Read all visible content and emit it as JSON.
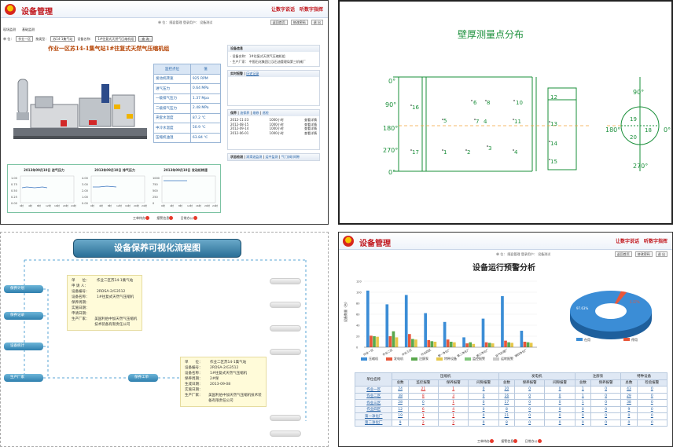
{
  "app": {
    "title": "设备管理",
    "slogan1": "让数字说话",
    "slogan2": "听数字指挥",
    "info": "单 位：   随县管理   登录用户：   设备测试",
    "links": [
      "返回首页",
      "修改密码",
      "退 出"
    ],
    "footer": [
      "工单待办",
      "报警信息",
      "日常办公"
    ]
  },
  "p1": {
    "nav": [
      "现场监测",
      "基础监测"
    ],
    "filter_unit_label": "单 位：",
    "filter_unit": "作业一区",
    "filter_type_label": "按类型：",
    "filter_type": "苏14-1集气站",
    "filter_device_label": "设备名称：",
    "filter_device": "1#往复式天然气压缩机组",
    "query": "查 询",
    "title": "作业一区苏14-1集气站1#往复式天然气压缩机组",
    "params_header": [
      "监控点位",
      "值"
    ],
    "params": [
      [
        "发动机转速",
        "925 RPM"
      ],
      [
        "进气压力",
        "0.64 MPa"
      ],
      [
        "一级排气压力",
        "1.37 Mpa"
      ],
      [
        "二级排气压力",
        "2.48 MPa"
      ],
      [
        "夹套水温度",
        "87.2 ℃"
      ],
      [
        "中冷水温度",
        "50.9 ℃"
      ],
      [
        "压缩机油温",
        "63.84 ℃"
      ]
    ],
    "info_box_title": "设备信息",
    "info_name": "· 设备名称：    1#往复式天然气压缩机组",
    "info_maker": "· 生产厂家：    中国石化集团江汉石油管理局第三机械厂",
    "alarm_title": "实时报警",
    "alarm_link": "历史记录",
    "list_title": "保养",
    "list_tabs": [
      "油保养",
      "维修",
      "巡检"
    ],
    "list": [
      [
        "2012-11-23",
        "1000小时",
        "查看详情"
      ],
      [
        "2012-08-15",
        "1000小时",
        "查看详情"
      ],
      [
        "2012-09-14",
        "1000小时",
        "查看详情"
      ],
      [
        "2012-06-01",
        "1000小时",
        "查看详情"
      ]
    ],
    "bottom_title": "状态检测",
    "bottom_links": [
      "润滑油监测",
      "运中监测",
      "气门(阀)间隙"
    ],
    "trend_titles": [
      "2013年09月10日 进气压力",
      "2013年09月10日 排气压力",
      "2013年09月10日 发动机转速"
    ],
    "trend_ylabels": [
      [
        "1.00",
        "0.75",
        "0.50",
        "0.25",
        "0.00"
      ],
      [
        "4.00",
        "3.00",
        "2.00",
        "1.00",
        "0.00"
      ],
      [
        "1000",
        "750",
        "500",
        "250",
        "0"
      ]
    ],
    "trend_xlabels": [
      "0时",
      "4时",
      "8时",
      "12时",
      "16时",
      "20时",
      "24时"
    ]
  },
  "p2": {
    "title": "壁厚测量点分布",
    "left_angles": [
      "0°",
      "90°",
      "180°",
      "270°",
      "0°"
    ],
    "points": [
      "16",
      "6",
      "8",
      "10",
      "12",
      "5",
      "7",
      "4",
      "11",
      "13",
      "17",
      "1",
      "2",
      "3",
      "4",
      "14",
      "15"
    ],
    "right_angles": [
      "90°",
      "180°",
      "0°",
      "270°"
    ],
    "right_points": [
      "19",
      "18",
      "20"
    ]
  },
  "p3": {
    "title": "设备保养可视化流程图",
    "nodes": [
      "保养计划",
      "保养记录",
      "设备统计",
      "生产厂家",
      "保养工单"
    ],
    "note_top": [
      [
        "单　　位：",
        "作业二区苏14-1集气站"
      ],
      [
        "申 请 人：",
        ""
      ],
      [
        "设备编号：",
        "2RDSA-2/G3512"
      ],
      [
        "设备名称：",
        "1#往复式天然气压缩机"
      ],
      [
        "保养周期：",
        ""
      ],
      [
        "实施日期：",
        ""
      ],
      [
        "申请日期：",
        ""
      ],
      [
        "生产厂家：",
        "美国利伯中加天然气压缩机技术装备有限责任公司"
      ]
    ],
    "note_bottom": [
      [
        "单　　位：",
        "作业二区苏14-1集气站"
      ],
      [
        "设备编号：",
        "2RDSA-2/G3512"
      ],
      [
        "设备名称：",
        "1#往复式天然气压缩机"
      ],
      [
        "保养周期：",
        "2#保"
      ],
      [
        "生成日期：",
        "2013-09-08"
      ],
      [
        "实施日期：",
        ""
      ],
      [
        "生产厂家：",
        "美国利伯中加天然气压缩机技术装备有限责任公司"
      ]
    ]
  },
  "p4": {
    "title": "设备运行预警分析",
    "chart_data": [
      {
        "type": "bar",
        "categories": [
          "作业一区",
          "作业二区",
          "作业三区",
          "作业四区",
          "第一净化厂",
          "第二净化厂",
          "第三净化厂",
          "采气处理厂",
          "第四净化厂"
        ],
        "series": [
          {
            "name": "压缩机",
            "values": [
              103,
              78,
              95,
              62,
              46,
              18,
              52,
              93,
              30
            ]
          },
          {
            "name": "发电机",
            "values": [
              21,
              20,
              24,
              13,
              14,
              7,
              9,
              12,
              10
            ]
          },
          {
            "name": "注醇泵",
            "values": [
              20,
              29,
              15,
              11,
              10,
              9,
              8,
              9,
              9
            ]
          },
          {
            "name": "特种设备",
            "values": [
              19,
              18,
              14,
              10,
              9,
              6,
              7,
              8,
              8
            ]
          }
        ],
        "ylabel": "设备数量（台）",
        "ylim": [
          0,
          120
        ],
        "yticks": [
          "0",
          "20",
          "40",
          "60",
          "80",
          "100",
          "120"
        ],
        "legend": [
          "压缩机",
          "发电机",
          "注醇泵",
          "特种设备",
          "监控报警",
          "运转报警"
        ]
      },
      {
        "type": "pie",
        "categories": [
          "在用",
          "停用"
        ],
        "values": [
          97.63,
          2.37
        ],
        "labels": [
          "97.63%",
          "2.37%"
        ]
      }
    ],
    "table_header_groups": [
      "单位名称",
      "压缩机",
      "发电机",
      "注醇泵",
      "特种设备"
    ],
    "table_subheaders": [
      "总数",
      "监控报警",
      "保养报警",
      "间隙报警",
      "总数",
      "保养报警",
      "间隙报警",
      "总数",
      "保养报警",
      "总数",
      "检验报警"
    ],
    "rows": [
      [
        "作业一区",
        "24",
        "21",
        "1",
        "0",
        "20",
        "0",
        "0",
        "1",
        "0",
        "43",
        "0"
      ],
      [
        "作业二区",
        "38",
        "8",
        "3",
        "0",
        "16",
        "0",
        "0",
        "1",
        "0",
        "29",
        "0"
      ],
      [
        "作业三区",
        "28",
        "0",
        "1",
        "0",
        "17",
        "0",
        "0",
        "1",
        "0",
        "38",
        "0"
      ],
      [
        "作业四区",
        "12",
        "6",
        "4",
        "0",
        "8",
        "0",
        "0",
        "0",
        "0",
        "9",
        "0"
      ],
      [
        "第一净化厂",
        "19",
        "1",
        "1",
        "0",
        "21",
        "0",
        "0",
        "0",
        "0",
        "0",
        "0"
      ],
      [
        "第二净化厂",
        "9",
        "2",
        "2",
        "0",
        "8",
        "0",
        "0",
        "0",
        "0",
        "0",
        "0"
      ]
    ]
  }
}
